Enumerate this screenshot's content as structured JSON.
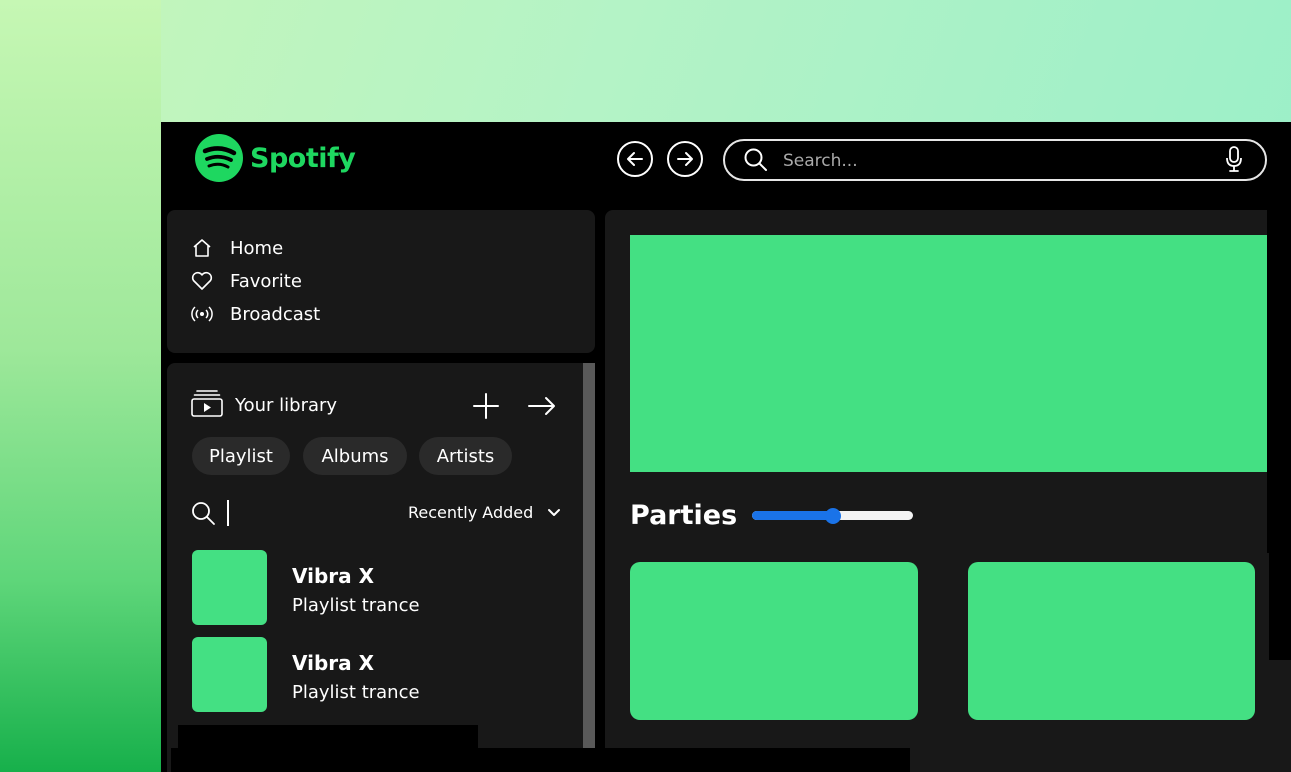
{
  "app": {
    "brand": "Spotify"
  },
  "topbar": {
    "back_icon": "arrow-left-circle-icon",
    "forward_icon": "arrow-right-circle-icon",
    "search": {
      "placeholder": "Search...",
      "value": "",
      "icon": "search-icon",
      "mic_icon": "microphone-icon"
    }
  },
  "sidebar": {
    "nav": [
      {
        "label": "Home",
        "icon": "home-icon"
      },
      {
        "label": "Favorite",
        "icon": "heart-icon"
      },
      {
        "label": "Broadcast",
        "icon": "broadcast-icon"
      }
    ]
  },
  "library": {
    "title": "Your library",
    "filters": [
      "Playlist",
      "Albums",
      "Artists"
    ],
    "sort_label": "Recently Added",
    "items": [
      {
        "title": "Vibra X",
        "subtitle": "Playlist trance"
      },
      {
        "title": "Vibra X",
        "subtitle": "Playlist trance"
      }
    ]
  },
  "main": {
    "section_title": "Parties",
    "slider_value": 0.5
  },
  "colors": {
    "accent": "#1ed760",
    "card": "#44e083",
    "panel": "#181818",
    "slider": "#1a73e8"
  }
}
